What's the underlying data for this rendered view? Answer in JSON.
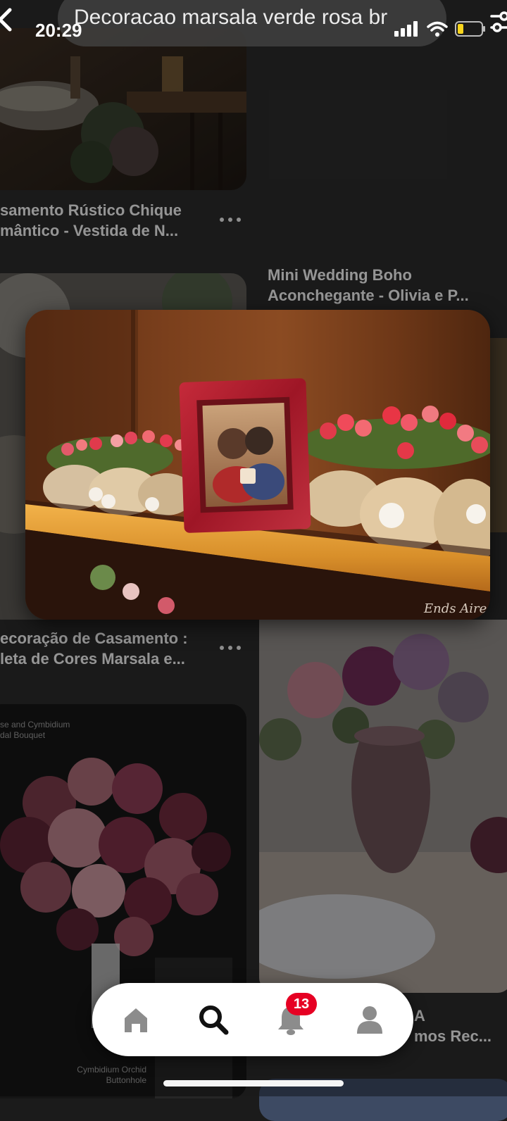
{
  "search": {
    "query": "Decoracao marsala verde rosa br"
  },
  "status_bar": {
    "time": "20:29"
  },
  "pins": [
    {
      "title_line1": "samento Rústico Chique",
      "title_line2": "mântico - Vestida de N..."
    },
    {
      "title_line1": "Mini Wedding Boho",
      "title_line2": "Aconchegante - Olivia e P..."
    },
    {
      "title_line1": "ecoração de Casamento :",
      "title_line2": "leta de Cores Marsala e..."
    },
    {
      "title_line1": "A",
      "title_line2": "mos Rec..."
    }
  ],
  "photo_texts": {
    "bouquet_caption_line1": "se and Cymbidium",
    "bouquet_caption_line2": "dal Bouquet",
    "buttonhole_line1": "Cymbidium Orchid",
    "buttonhole_line2": "Buttonhole",
    "watermark": "Ends Aires"
  },
  "bottom_nav": {
    "items": [
      "home-icon",
      "search-icon",
      "bell-icon",
      "profile-icon"
    ],
    "notification_count": "13"
  },
  "colors": {
    "accent": "#e60023",
    "battery_low": "#f7d41c"
  }
}
